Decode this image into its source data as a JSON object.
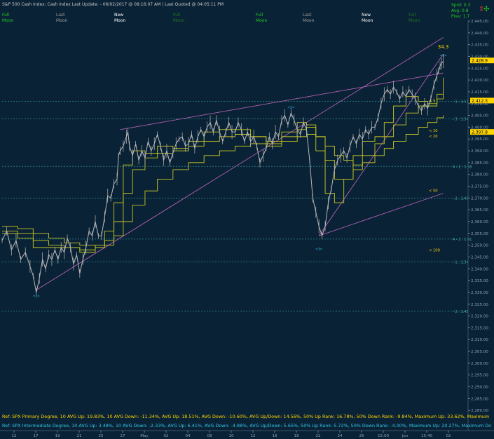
{
  "header": {
    "title": "S&P 500 Cash Index;  Cash Index  Last Update: - 06/02/2017 @ 08:16:07 AM | Last Quoted @ 04:05:11 PM",
    "row1": [
      "Full",
      "Last",
      "New",
      "Full",
      "Full",
      "Last",
      "New",
      "Full"
    ],
    "row2": [
      "Moon",
      "Moon",
      "Moon",
      "Moon",
      "Moon",
      "Moon",
      "Moon",
      "Moon"
    ],
    "stats": [
      "Sprd: 0.3",
      "Avg: 0.8",
      "Prev: 1.7"
    ]
  },
  "colors": {
    "background": "#0a2236",
    "price": "#b8b8b8",
    "channel": "#b060b0",
    "moving_average": "#c8c820",
    "pivot_line": "#2a8c8c",
    "full_moon": "#22cc22",
    "new_moon": "#ffffff",
    "label": "#ffd500",
    "ref_primary": "#ffd500",
    "ref_intermediate": "#33c6e6"
  },
  "chart_data": {
    "type": "line",
    "title": "",
    "ylim": [
      2275,
      2445
    ],
    "y_ticks": [
      "2,445.00",
      "2,440.00",
      "2,435.00",
      "2,430.00",
      "2,425.00",
      "2,420.00",
      "2,415.00",
      "2,410.00",
      "2,405.00",
      "2,400.00",
      "2,395.00",
      "2,390.00",
      "2,385.00",
      "2,380.00",
      "2,375.00",
      "2,370.00",
      "2,365.00",
      "2,360.00",
      "2,355.00",
      "2,350.00",
      "2,345.00",
      "2,340.00",
      "2,335.00",
      "2,330.00",
      "2,325.00",
      "2,320.00",
      "2,315.00",
      "2,310.00",
      "2,305.00",
      "2,300.00",
      "2,295.00",
      "2,290.00",
      "2,285.00",
      "2,280.00"
    ],
    "x_ticks": [
      "12",
      "17",
      "19",
      "21",
      "25",
      "27",
      "May",
      "02",
      "04",
      "08",
      "10",
      "12",
      "16",
      "18",
      "22",
      "24",
      "26",
      "15:00",
      "Jun",
      "15:40",
      "02"
    ],
    "price_series": {
      "name": "S&P 500",
      "points": [
        [
          0,
          2352
        ],
        [
          3,
          2356
        ],
        [
          6,
          2348
        ],
        [
          9,
          2352
        ],
        [
          12,
          2344
        ],
        [
          15,
          2347
        ],
        [
          18,
          2341
        ],
        [
          20,
          2337
        ],
        [
          22,
          2330
        ],
        [
          24,
          2336
        ],
        [
          26,
          2344
        ],
        [
          28,
          2340
        ],
        [
          30,
          2346
        ],
        [
          32,
          2344
        ],
        [
          34,
          2348
        ],
        [
          36,
          2344
        ],
        [
          38,
          2349
        ],
        [
          40,
          2347
        ],
        [
          42,
          2353
        ],
        [
          44,
          2349
        ],
        [
          46,
          2342
        ],
        [
          48,
          2346
        ],
        [
          50,
          2338
        ],
        [
          52,
          2344
        ],
        [
          54,
          2349
        ],
        [
          56,
          2356
        ],
        [
          58,
          2354
        ],
        [
          60,
          2360
        ],
        [
          62,
          2354
        ],
        [
          64,
          2354
        ],
        [
          66,
          2362
        ],
        [
          68,
          2371
        ],
        [
          70,
          2370
        ],
        [
          72,
          2376
        ],
        [
          74,
          2378
        ],
        [
          75,
          2388
        ],
        [
          76,
          2390
        ],
        [
          78,
          2392
        ],
        [
          80,
          2396
        ],
        [
          81,
          2398
        ],
        [
          82,
          2392
        ],
        [
          84,
          2388
        ],
        [
          86,
          2393
        ],
        [
          88,
          2386
        ],
        [
          90,
          2390
        ],
        [
          92,
          2387
        ],
        [
          94,
          2394
        ],
        [
          96,
          2390
        ],
        [
          98,
          2393
        ],
        [
          100,
          2397
        ],
        [
          102,
          2392
        ],
        [
          104,
          2386
        ],
        [
          106,
          2390
        ],
        [
          108,
          2385
        ],
        [
          110,
          2389
        ],
        [
          112,
          2393
        ],
        [
          114,
          2395
        ],
        [
          116,
          2396
        ],
        [
          118,
          2392
        ],
        [
          120,
          2393
        ],
        [
          122,
          2397
        ],
        [
          124,
          2391
        ],
        [
          126,
          2396
        ],
        [
          128,
          2399
        ],
        [
          130,
          2396
        ],
        [
          132,
          2400
        ],
        [
          134,
          2402
        ],
        [
          136,
          2398
        ],
        [
          138,
          2403
        ],
        [
          140,
          2398
        ],
        [
          142,
          2394
        ],
        [
          144,
          2398
        ],
        [
          146,
          2402
        ],
        [
          148,
          2398
        ],
        [
          150,
          2398
        ],
        [
          152,
          2402
        ],
        [
          154,
          2399
        ],
        [
          156,
          2394
        ],
        [
          158,
          2398
        ],
        [
          160,
          2394
        ],
        [
          162,
          2396
        ],
        [
          164,
          2392
        ],
        [
          166,
          2385
        ],
        [
          168,
          2388
        ],
        [
          170,
          2391
        ],
        [
          172,
          2396
        ],
        [
          174,
          2393
        ],
        [
          176,
          2398
        ],
        [
          178,
          2396
        ],
        [
          180,
          2403
        ],
        [
          182,
          2405
        ],
        [
          184,
          2401
        ],
        [
          186,
          2406
        ],
        [
          188,
          2403
        ],
        [
          190,
          2399
        ],
        [
          192,
          2397
        ],
        [
          194,
          2402
        ],
        [
          196,
          2399
        ],
        [
          198,
          2386
        ],
        [
          200,
          2370
        ],
        [
          202,
          2364
        ],
        [
          204,
          2358
        ],
        [
          206,
          2354
        ],
        [
          208,
          2358
        ],
        [
          210,
          2368
        ],
        [
          212,
          2374
        ],
        [
          214,
          2382
        ],
        [
          216,
          2386
        ],
        [
          218,
          2388
        ],
        [
          220,
          2390
        ],
        [
          222,
          2387
        ],
        [
          224,
          2392
        ],
        [
          226,
          2396
        ],
        [
          228,
          2393
        ],
        [
          230,
          2397
        ],
        [
          232,
          2395
        ],
        [
          234,
          2399
        ],
        [
          236,
          2397
        ],
        [
          238,
          2400
        ],
        [
          240,
          2400
        ],
        [
          242,
          2404
        ],
        [
          244,
          2410
        ],
        [
          246,
          2414
        ],
        [
          248,
          2416
        ],
        [
          250,
          2414
        ],
        [
          252,
          2417
        ],
        [
          254,
          2415
        ],
        [
          256,
          2412
        ],
        [
          258,
          2415
        ],
        [
          260,
          2413
        ],
        [
          262,
          2416
        ],
        [
          264,
          2414
        ],
        [
          266,
          2412
        ],
        [
          268,
          2409
        ],
        [
          270,
          2407
        ],
        [
          272,
          2410
        ],
        [
          274,
          2408
        ],
        [
          276,
          2412
        ],
        [
          278,
          2418
        ],
        [
          280,
          2422
        ],
        [
          281,
          2424
        ],
        [
          282,
          2426
        ],
        [
          283,
          2427
        ],
        [
          284,
          2428
        ]
      ]
    },
    "moving_averages": [
      {
        "label": "< 5",
        "points": [
          [
            0,
            2355
          ],
          [
            10,
            2353
          ],
          [
            20,
            2349
          ],
          [
            30,
            2349
          ],
          [
            40,
            2349
          ],
          [
            50,
            2347
          ],
          [
            60,
            2350
          ],
          [
            66,
            2356
          ],
          [
            72,
            2368
          ],
          [
            78,
            2384
          ],
          [
            84,
            2390
          ],
          [
            92,
            2389
          ],
          [
            100,
            2392
          ],
          [
            110,
            2391
          ],
          [
            120,
            2394
          ],
          [
            130,
            2398
          ],
          [
            140,
            2399
          ],
          [
            150,
            2399
          ],
          [
            160,
            2396
          ],
          [
            170,
            2392
          ],
          [
            180,
            2398
          ],
          [
            190,
            2402
          ],
          [
            196,
            2401
          ],
          [
            202,
            2390
          ],
          [
            208,
            2372
          ],
          [
            214,
            2368
          ],
          [
            220,
            2378
          ],
          [
            226,
            2388
          ],
          [
            232,
            2394
          ],
          [
            240,
            2396
          ],
          [
            246,
            2402
          ],
          [
            252,
            2409
          ],
          [
            260,
            2413
          ],
          [
            268,
            2411
          ],
          [
            274,
            2409
          ],
          [
            280,
            2414
          ],
          [
            284,
            2421
          ]
        ]
      },
      {
        "label": "< 10",
        "points": [
          [
            0,
            2356
          ],
          [
            10,
            2355
          ],
          [
            20,
            2352
          ],
          [
            30,
            2350
          ],
          [
            40,
            2349
          ],
          [
            50,
            2348
          ],
          [
            60,
            2349
          ],
          [
            66,
            2352
          ],
          [
            72,
            2360
          ],
          [
            78,
            2372
          ],
          [
            84,
            2382
          ],
          [
            92,
            2387
          ],
          [
            100,
            2389
          ],
          [
            110,
            2390
          ],
          [
            120,
            2392
          ],
          [
            130,
            2394
          ],
          [
            140,
            2396
          ],
          [
            150,
            2397
          ],
          [
            160,
            2396
          ],
          [
            170,
            2394
          ],
          [
            180,
            2396
          ],
          [
            190,
            2399
          ],
          [
            196,
            2400
          ],
          [
            202,
            2396
          ],
          [
            208,
            2386
          ],
          [
            214,
            2378
          ],
          [
            220,
            2378
          ],
          [
            226,
            2382
          ],
          [
            232,
            2388
          ],
          [
            240,
            2393
          ],
          [
            246,
            2396
          ],
          [
            252,
            2401
          ],
          [
            260,
            2406
          ],
          [
            268,
            2409
          ],
          [
            274,
            2410
          ],
          [
            280,
            2412
          ],
          [
            284,
            2414
          ]
        ]
      },
      {
        "label": "< 20",
        "points": [
          [
            0,
            2358
          ],
          [
            10,
            2357
          ],
          [
            20,
            2355
          ],
          [
            30,
            2353
          ],
          [
            40,
            2351
          ],
          [
            50,
            2350
          ],
          [
            60,
            2349
          ],
          [
            66,
            2350
          ],
          [
            72,
            2354
          ],
          [
            78,
            2360
          ],
          [
            84,
            2367
          ],
          [
            92,
            2373
          ],
          [
            100,
            2378
          ],
          [
            110,
            2382
          ],
          [
            120,
            2385
          ],
          [
            130,
            2388
          ],
          [
            140,
            2390
          ],
          [
            150,
            2392
          ],
          [
            160,
            2393
          ],
          [
            170,
            2393
          ],
          [
            180,
            2394
          ],
          [
            190,
            2396
          ],
          [
            196,
            2397
          ],
          [
            202,
            2396
          ],
          [
            208,
            2392
          ],
          [
            214,
            2388
          ],
          [
            220,
            2386
          ],
          [
            226,
            2384
          ],
          [
            232,
            2385
          ],
          [
            240,
            2388
          ],
          [
            246,
            2391
          ],
          [
            252,
            2394
          ],
          [
            260,
            2397
          ],
          [
            268,
            2400
          ],
          [
            274,
            2402
          ],
          [
            280,
            2404
          ],
          [
            284,
            2405
          ]
        ]
      }
    ],
    "channel_lines": [
      [
        [
          22,
          2331
        ],
        [
          284,
          2438
        ]
      ],
      [
        [
          76,
          2399
        ],
        [
          284,
          2423
        ]
      ],
      [
        [
          204,
          2354
        ],
        [
          284,
          2431
        ]
      ],
      [
        [
          204,
          2354
        ],
        [
          284,
          2372
        ]
      ]
    ],
    "pivot_levels": [
      {
        "y": 2411.0,
        "label": "- 1 : 1:11"
      },
      {
        "y": 2403.5,
        "label": "- 3 : 1:34"
      },
      {
        "y": 2383.4,
        "label": "4 - 1 : 1:58"
      },
      {
        "y": 2370.0,
        "label": "- 2 : 1:48"
      },
      {
        "y": 2352.6,
        "label": "4 - 2 : 1:41"
      },
      {
        "y": 2342.9,
        "label": "- 1 : 1:34"
      },
      {
        "y": 2322.0,
        "label": "- 2 : 1:48"
      }
    ],
    "ma_labels": [
      {
        "y": 2411.3,
        "label": "< 5"
      },
      {
        "y": 2398.6,
        "label": "< 10"
      },
      {
        "y": 2396.2,
        "label": "< 20"
      },
      {
        "y": 2373.2,
        "label": "< 50"
      },
      {
        "y": 2347.9,
        "label": "< 100"
      }
    ],
    "price_tags": [
      {
        "y": 2428.3,
        "label": "2,428.9"
      },
      {
        "y": 2411.3,
        "label": "2,412.3"
      },
      {
        "y": 2398.0,
        "label": "2,397.8"
      }
    ],
    "annotation": {
      "x": 284,
      "y": 2434,
      "label": "34.3"
    },
    "wave_marks": [
      {
        "x": 22,
        "y": 2328,
        "label": "<1>"
      },
      {
        "x": 186,
        "y": 2408,
        "label": "<2>"
      },
      {
        "x": 204,
        "y": 2348,
        "label": "<3>"
      },
      {
        "x": 284,
        "y": 2430,
        "label": "<3>"
      }
    ]
  },
  "footer": {
    "ref_primary": "Ref: SPX Primary Degree, 10 AVG Up: 19.83%, 10 AVG Down: -11.34%, AVG Up: 18.51%, AVG Down: -10.60%, AVG Up/Down: 14.56%, 50%  Up Rank: 16.78%, 50% Down Rank: -9.84%, Maximum Up: 33.62%, Maximum",
    "ref_intermediate": "Ref: SPX Intermediate Degree, 10 AVG Up: 3.48%, 10 AVG Down: -2.33%, AVG Up: 6.41%, AVG Down: -4.88%, AVG Up/Down: 5.65%, 50%  Up Rank: 5.72%, 50% Down Rank: -4.00%, Maximum Up: 20.27%, Maximum Do"
  }
}
